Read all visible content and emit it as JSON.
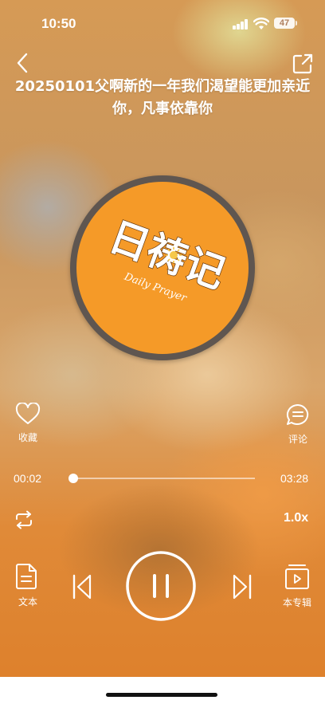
{
  "status_bar": {
    "time": "10:50",
    "battery": "47"
  },
  "header": {
    "title": "20250101父啊新的一年我们渴望能更加亲近你，凡事依靠你",
    "back_icon": "chevron-left-icon",
    "share_icon": "share-icon"
  },
  "album_art": {
    "logo_text": "日祷记",
    "subtitle": "Daily Prayer",
    "colors": {
      "ring": "#5f5650",
      "fill": "#f59a28"
    }
  },
  "actions": {
    "favorite_label": "收藏",
    "comment_label": "评论"
  },
  "progress": {
    "current": "00:02",
    "total": "03:28",
    "fraction": 0.01
  },
  "playback": {
    "speed": "1.0x",
    "repeat_icon": "repeat-icon",
    "state": "playing"
  },
  "bottom_bar": {
    "text_label": "文本",
    "album_label": "本专辑"
  }
}
